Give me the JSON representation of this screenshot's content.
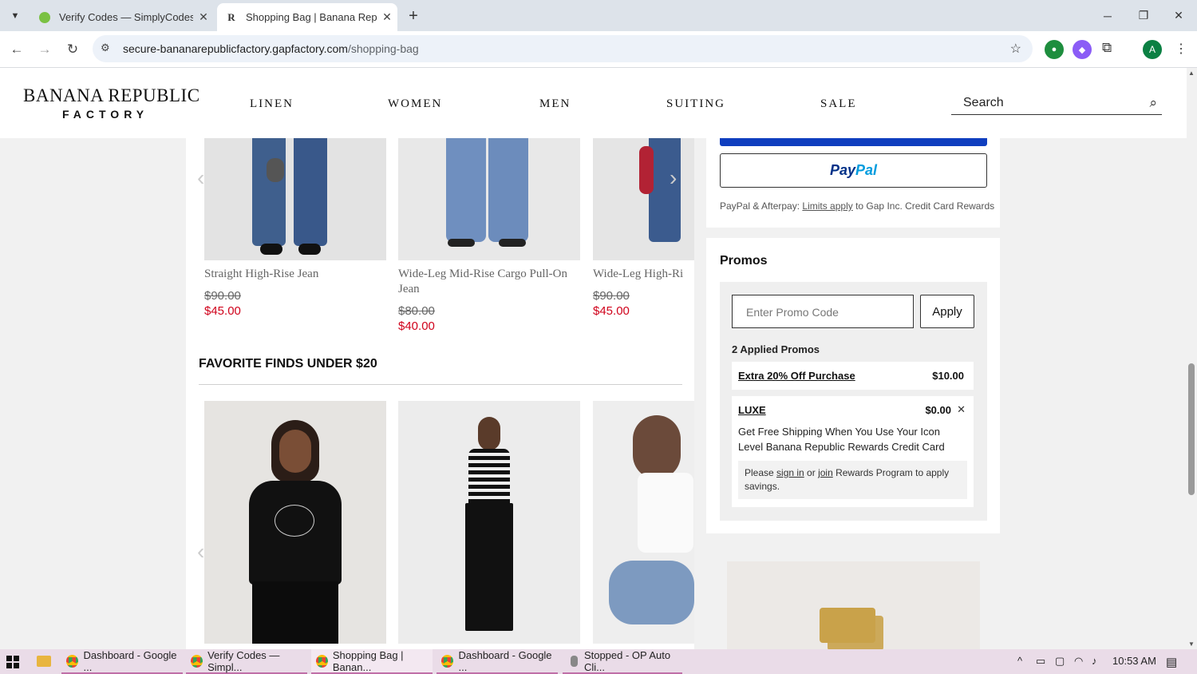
{
  "browser": {
    "tabs": [
      {
        "title": "Verify Codes — SimplyCodes",
        "active": false
      },
      {
        "title": "Shopping Bag | Banana Republi",
        "active": true
      }
    ],
    "new_tab": "+",
    "url_domain": "secure-bananarepublicfactory.gapfactory.com",
    "url_path": "/shopping-bag",
    "profile_initial": "A",
    "window_controls": {
      "minimize": "─",
      "restore": "❐",
      "close": "✕"
    }
  },
  "site": {
    "logo_top": "BANANA REPUBLIC",
    "logo_bottom": "FACTORY",
    "nav": [
      "LINEN",
      "WOMEN",
      "MEN",
      "SUITING",
      "SALE"
    ],
    "search_label": "Search"
  },
  "recommendations": {
    "row1": [
      {
        "title": "Straight High-Rise Jean",
        "old_price": "$90.00",
        "price": "$45.00"
      },
      {
        "title": "Wide-Leg Mid-Rise Cargo Pull-On Jean",
        "old_price": "$80.00",
        "price": "$40.00"
      },
      {
        "title": "Wide-Leg High-Ri",
        "old_price": "$90.00",
        "price": "$45.00"
      }
    ],
    "section_title": "FAVORITE FINDS UNDER $20"
  },
  "payment": {
    "paypal_a": "Pay",
    "paypal_b": "Pal",
    "note_prefix": "PayPal & Afterpay: ",
    "note_link": "Limits apply",
    "note_suffix": " to Gap Inc. Credit Card Rewards"
  },
  "promos": {
    "title": "Promos",
    "placeholder": "Enter Promo Code",
    "apply_label": "Apply",
    "applied_label": "2 Applied Promos",
    "items": [
      {
        "name": "Extra 20% Off Purchase",
        "amount": "$10.00"
      },
      {
        "name": "LUXE",
        "amount": "$0.00",
        "remove": "✕",
        "description": "Get Free Shipping When You Use Your Icon Level Banana Republic Rewards Credit Card",
        "note_a": "Please ",
        "note_signin": "sign in",
        "note_b": " or ",
        "note_join": "join",
        "note_c": " Rewards Program to apply savings."
      }
    ]
  },
  "taskbar": {
    "items": [
      {
        "label": "Dashboard - Google ..."
      },
      {
        "label": "Verify Codes — Simpl..."
      },
      {
        "label": "Shopping Bag | Banan..."
      },
      {
        "label": "Dashboard - Google ..."
      },
      {
        "label": "Stopped - OP Auto Cli..."
      }
    ],
    "time": "10:53 AM"
  }
}
